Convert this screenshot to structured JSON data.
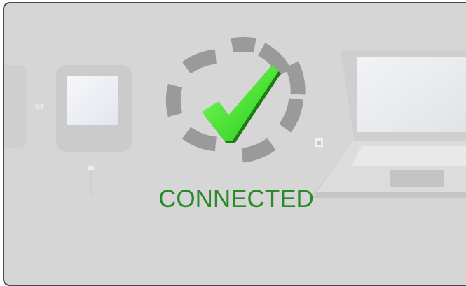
{
  "connection": {
    "status_text": "CONNECTED",
    "or_label": "or",
    "status_color": "#2a8a2a",
    "checkmark_color": "#3ee02a",
    "panel_color": "#d6d6d6"
  },
  "icons": {
    "checkmark": "checkmark-icon",
    "ring": "progress-ring-icon",
    "tablet": "tablet-device-icon",
    "laptop": "laptop-icon",
    "cable": "usb-cable-icon"
  }
}
